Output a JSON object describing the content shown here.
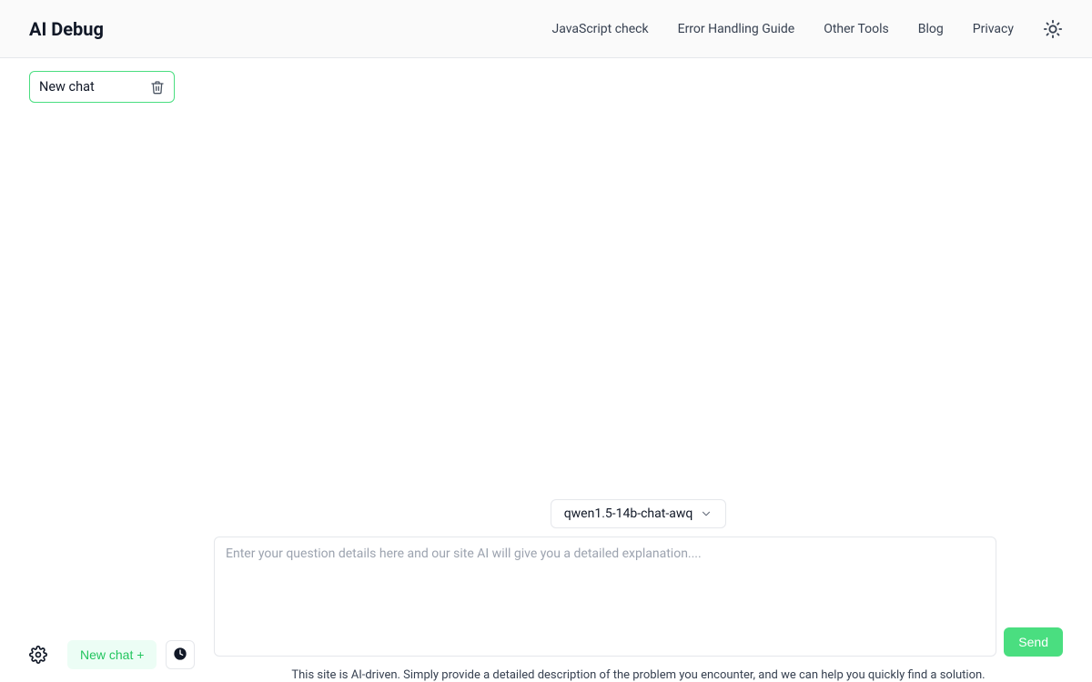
{
  "header": {
    "logo": "AI Debug",
    "nav": {
      "javascript_check": "JavaScript check",
      "error_guide": "Error Handling Guide",
      "other_tools": "Other Tools",
      "blog": "Blog",
      "privacy": "Privacy"
    }
  },
  "sidebar": {
    "chat_item_label": "New chat",
    "new_chat_button": "New chat +"
  },
  "main": {
    "model_selector": "qwen1.5-14b-chat-awq",
    "input_placeholder": "Enter your question details here and our site AI will give you a detailed explanation....",
    "send_button": "Send",
    "disclaimer": "This site is AI-driven. Simply provide a detailed description of the problem you encounter, and we can help you quickly find a solution."
  }
}
